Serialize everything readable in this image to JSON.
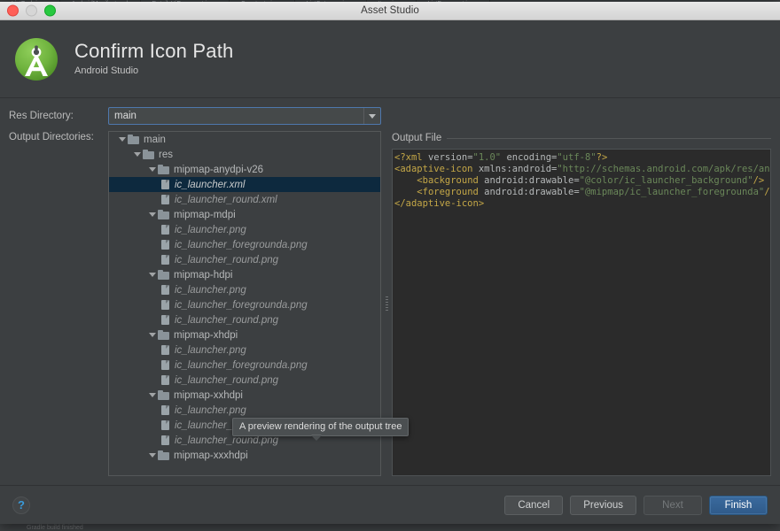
{
  "ide_background": {
    "tabs": [
      {
        "label": "ListTask.java"
      },
      {
        "label": "AndroidManifest.xml"
      },
      {
        "label": "DetailsUiFragment.java"
      },
      {
        "label": "Constants.java"
      },
      {
        "label": "ListCategory.java"
      },
      {
        "label": "Item.java"
      },
      {
        "label": "ListFragment.java"
      }
    ],
    "status_text": "Gradle build finished"
  },
  "window": {
    "title": "Asset Studio"
  },
  "titlebar": {
    "close_label": "close",
    "minimize_label": "minimize",
    "maximize_label": "maximize"
  },
  "header": {
    "title": "Confirm Icon Path",
    "subtitle": "Android Studio",
    "logo_name": "android-studio-logo"
  },
  "form": {
    "res_directory_label": "Res Directory:",
    "res_directory_value": "main",
    "output_directories_label": "Output Directories:"
  },
  "tree": {
    "rows": [
      {
        "depth": 0,
        "type": "folder",
        "expanded": true,
        "label": "main",
        "selected": false
      },
      {
        "depth": 1,
        "type": "folder",
        "expanded": true,
        "label": "res",
        "selected": false
      },
      {
        "depth": 2,
        "type": "folder",
        "expanded": true,
        "label": "mipmap-anydpi-v26",
        "selected": false
      },
      {
        "depth": 3,
        "type": "file",
        "expanded": false,
        "label": "ic_launcher.xml",
        "selected": true
      },
      {
        "depth": 3,
        "type": "file",
        "expanded": false,
        "label": "ic_launcher_round.xml",
        "selected": false
      },
      {
        "depth": 2,
        "type": "folder",
        "expanded": true,
        "label": "mipmap-mdpi",
        "selected": false
      },
      {
        "depth": 3,
        "type": "file",
        "expanded": false,
        "label": "ic_launcher.png",
        "selected": false
      },
      {
        "depth": 3,
        "type": "file",
        "expanded": false,
        "label": "ic_launcher_foregrounda.png",
        "selected": false
      },
      {
        "depth": 3,
        "type": "file",
        "expanded": false,
        "label": "ic_launcher_round.png",
        "selected": false
      },
      {
        "depth": 2,
        "type": "folder",
        "expanded": true,
        "label": "mipmap-hdpi",
        "selected": false
      },
      {
        "depth": 3,
        "type": "file",
        "expanded": false,
        "label": "ic_launcher.png",
        "selected": false
      },
      {
        "depth": 3,
        "type": "file",
        "expanded": false,
        "label": "ic_launcher_foregrounda.png",
        "selected": false
      },
      {
        "depth": 3,
        "type": "file",
        "expanded": false,
        "label": "ic_launcher_round.png",
        "selected": false
      },
      {
        "depth": 2,
        "type": "folder",
        "expanded": true,
        "label": "mipmap-xhdpi",
        "selected": false
      },
      {
        "depth": 3,
        "type": "file",
        "expanded": false,
        "label": "ic_launcher.png",
        "selected": false
      },
      {
        "depth": 3,
        "type": "file",
        "expanded": false,
        "label": "ic_launcher_foregrounda.png",
        "selected": false
      },
      {
        "depth": 3,
        "type": "file",
        "expanded": false,
        "label": "ic_launcher_round.png",
        "selected": false
      },
      {
        "depth": 2,
        "type": "folder",
        "expanded": true,
        "label": "mipmap-xxhdpi",
        "selected": false
      },
      {
        "depth": 3,
        "type": "file",
        "expanded": false,
        "label": "ic_launcher.png",
        "selected": false
      },
      {
        "depth": 3,
        "type": "file",
        "expanded": false,
        "label": "ic_launcher_foregrounda.png",
        "selected": false
      },
      {
        "depth": 3,
        "type": "file",
        "expanded": false,
        "label": "ic_launcher_round.png",
        "selected": false
      },
      {
        "depth": 2,
        "type": "folder",
        "expanded": true,
        "label": "mipmap-xxxhdpi",
        "selected": false
      }
    ]
  },
  "tooltip": {
    "text": "A preview rendering of the output tree"
  },
  "output": {
    "group_title": "Output File",
    "code_lines": [
      [
        {
          "t": "tag",
          "s": "<?xml"
        },
        {
          "t": "plain",
          "s": " "
        },
        {
          "t": "attr",
          "s": "version="
        },
        {
          "t": "str",
          "s": "\"1.0\""
        },
        {
          "t": "plain",
          "s": " "
        },
        {
          "t": "attr",
          "s": "encoding="
        },
        {
          "t": "str",
          "s": "\"utf-8\""
        },
        {
          "t": "tag",
          "s": "?>"
        }
      ],
      [
        {
          "t": "tag",
          "s": "<adaptive-icon"
        },
        {
          "t": "plain",
          "s": " "
        },
        {
          "t": "attr",
          "s": "xmlns:android="
        },
        {
          "t": "str",
          "s": "\"http://schemas.android.com/apk/res/andro"
        }
      ],
      [
        {
          "t": "plain",
          "s": "    "
        },
        {
          "t": "tag",
          "s": "<background"
        },
        {
          "t": "plain",
          "s": " "
        },
        {
          "t": "attr",
          "s": "android:drawable="
        },
        {
          "t": "str",
          "s": "\"@color/ic_launcher_background\""
        },
        {
          "t": "tag",
          "s": "/>"
        }
      ],
      [
        {
          "t": "plain",
          "s": "    "
        },
        {
          "t": "tag",
          "s": "<foreground"
        },
        {
          "t": "plain",
          "s": " "
        },
        {
          "t": "attr",
          "s": "android:drawable="
        },
        {
          "t": "str",
          "s": "\"@mipmap/ic_launcher_foregrounda\""
        },
        {
          "t": "tag",
          "s": "/>"
        }
      ],
      [
        {
          "t": "tag",
          "s": "</adaptive-icon>"
        }
      ]
    ]
  },
  "footer": {
    "help_label": "?",
    "buttons": [
      {
        "label": "Cancel",
        "state": "normal"
      },
      {
        "label": "Previous",
        "state": "normal"
      },
      {
        "label": "Next",
        "state": "disabled"
      },
      {
        "label": "Finish",
        "state": "primary"
      }
    ]
  },
  "colors": {
    "window_bg": "#3c3f41",
    "code_bg": "#2b2b2b",
    "selection": "#0d293e",
    "focus_border": "#4e78ad",
    "accent_primary": "#3a6a9e",
    "help_blue": "#3a9ad9",
    "logo_green": "#6aad3d",
    "xml_tag": "#c4a747",
    "xml_string": "#6a8759",
    "xml_attr": "#b5b8b9"
  }
}
